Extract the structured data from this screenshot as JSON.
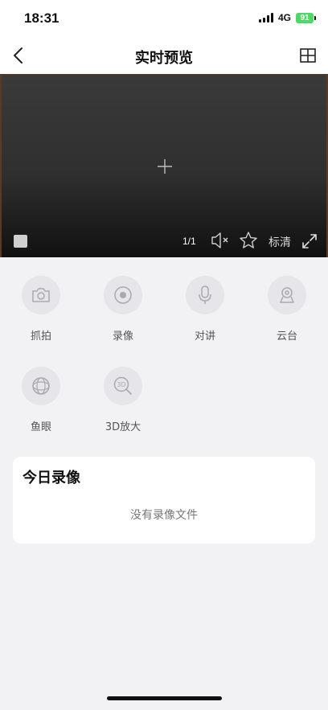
{
  "status_bar": {
    "time": "18:31",
    "network": "4G",
    "battery": "91"
  },
  "nav": {
    "title": "实时预览",
    "back_icon": "chevron-left-icon",
    "layout_icon": "grid-layout-icon"
  },
  "video": {
    "page_indicator": "1/1",
    "quality_label": "标清"
  },
  "functions": [
    {
      "label": "抓拍",
      "icon": "camera-icon"
    },
    {
      "label": "录像",
      "icon": "record-icon"
    },
    {
      "label": "对讲",
      "icon": "microphone-icon"
    },
    {
      "label": "云台",
      "icon": "ptz-icon"
    },
    {
      "label": "鱼眼",
      "icon": "fisheye-icon"
    },
    {
      "label": "3D放大",
      "icon": "zoom-3d-icon"
    }
  ],
  "today_records": {
    "title": "今日录像",
    "empty_text": "没有录像文件"
  },
  "colors": {
    "accent_battery": "#4cd964",
    "icon_gray": "#a9a9ae",
    "page_background": "#f2f2f4"
  }
}
